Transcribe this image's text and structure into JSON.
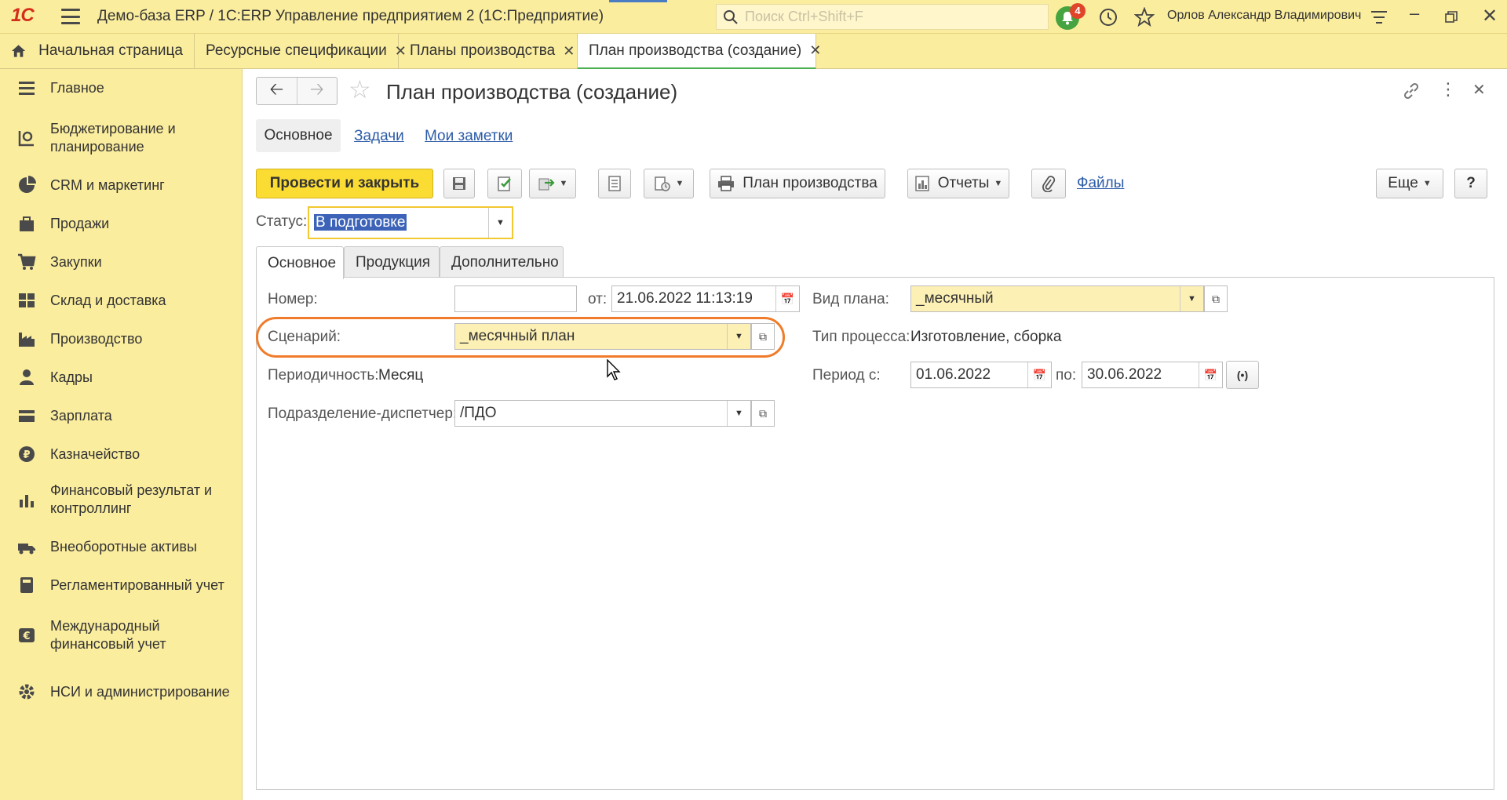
{
  "titlebar": {
    "logo_text": "1С",
    "app_title": "Демо-база ERP / 1С:ERP Управление предприятием 2  (1С:Предприятие)",
    "search_placeholder": "Поиск Ctrl+Shift+F",
    "notifications_count": "4",
    "user_name": "Орлов Александр Владимирович"
  },
  "tabs": [
    {
      "label": "Начальная страница"
    },
    {
      "label": "Ресурсные спецификации"
    },
    {
      "label": "Планы производства"
    },
    {
      "label": "План производства (создание)"
    }
  ],
  "sidebar": {
    "items": [
      {
        "label": "Главное",
        "icon": "menu-icon"
      },
      {
        "label": "Бюджетирование и планирование",
        "icon": "budget-icon"
      },
      {
        "label": "CRM и маркетинг",
        "icon": "pie-chart-icon"
      },
      {
        "label": "Продажи",
        "icon": "bag-icon"
      },
      {
        "label": "Закупки",
        "icon": "cart-icon"
      },
      {
        "label": "Склад и доставка",
        "icon": "warehouse-icon"
      },
      {
        "label": "Производство",
        "icon": "factory-icon"
      },
      {
        "label": "Кадры",
        "icon": "person-icon"
      },
      {
        "label": "Зарплата",
        "icon": "wallet-icon"
      },
      {
        "label": "Казначейство",
        "icon": "coin-icon"
      },
      {
        "label": "Финансовый результат и контроллинг",
        "icon": "bar-chart-icon"
      },
      {
        "label": "Внеоборотные активы",
        "icon": "truck-icon"
      },
      {
        "label": "Регламентированный учет",
        "icon": "calculator-icon"
      },
      {
        "label": "Международный финансовый учет",
        "icon": "euro-icon"
      },
      {
        "label": "НСИ и администрирование",
        "icon": "gear-icon"
      }
    ]
  },
  "document": {
    "title": "План производства (создание)",
    "subnav": {
      "main": "Основное",
      "tasks": "Задачи",
      "notes": "Мои заметки"
    },
    "toolbar": {
      "post_close": "Провести и закрыть",
      "print_plan": "План производства",
      "reports": "Отчеты",
      "files": "Файлы",
      "more": "Еще",
      "help": "?"
    },
    "status": {
      "label": "Статус:",
      "value": "В подготовке"
    },
    "form_tabs": [
      "Основное",
      "Продукция",
      "Дополнительно"
    ],
    "fields": {
      "number_label": "Номер:",
      "number_value": "",
      "from_label": "от:",
      "date_value": "21.06.2022 11:13:19",
      "plan_type_label": "Вид плана:",
      "plan_type_value": "_месячный",
      "scenario_label": "Сценарий:",
      "scenario_value": "_месячный план",
      "process_type_label": "Тип процесса:",
      "process_type_value": "Изготовление, сборка",
      "periodicity_label": "Периодичность:",
      "periodicity_value": "Месяц",
      "period_from_label": "Период с:",
      "period_from_value": "01.06.2022",
      "period_to_label": "по:",
      "period_to_value": "30.06.2022",
      "division_label": "Подразделение-диспетчер:",
      "division_value": "/ПДО"
    }
  },
  "colors": {
    "panel_yellow": "#fbed9e",
    "primary_button": "#fbdc32",
    "highlight_orange": "#f07c2b",
    "active_tab_underline": "#4caf50",
    "link_blue": "#2b5ba8"
  }
}
